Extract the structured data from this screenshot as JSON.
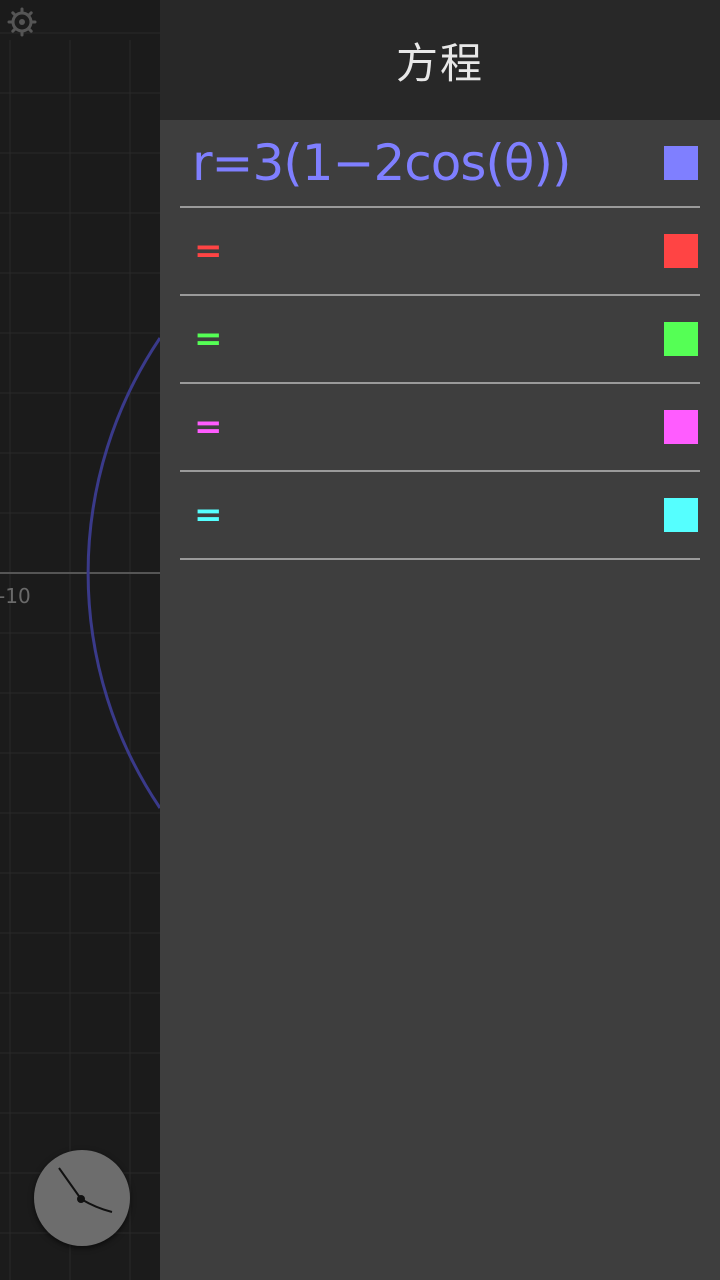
{
  "drawer": {
    "title": "方程"
  },
  "graph": {
    "axis_label": "-10",
    "curve_color": "#3a3a8a",
    "grid_color": "#2a2a2a",
    "axis_color": "#555555"
  },
  "equations": [
    {
      "text": "r=3(1−2cos(θ))",
      "color": "#7f7fff"
    },
    {
      "text": "=",
      "color": "#ff4444"
    },
    {
      "text": "=",
      "color": "#55ff55"
    },
    {
      "text": "=",
      "color": "#ff5cff"
    },
    {
      "text": "=",
      "color": "#55ffff"
    }
  ],
  "icons": {
    "settings": "gear-icon",
    "clock": "clock-icon"
  }
}
